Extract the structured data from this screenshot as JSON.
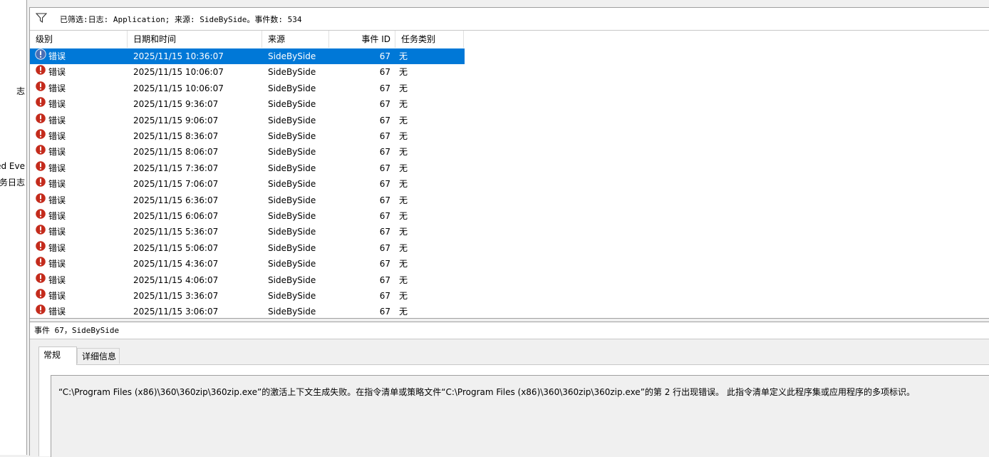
{
  "left_tree": {
    "items": [
      "志",
      "ed Eve",
      "务日志"
    ]
  },
  "filter_bar": {
    "text": "已筛选:日志: Application; 来源: SideBySide。事件数: 534"
  },
  "columns": {
    "level": "级别",
    "datetime": "日期和时间",
    "source": "来源",
    "event_id": "事件 ID",
    "task_category": "任务类别"
  },
  "events": [
    {
      "level": "错误",
      "datetime": "2025/11/15 10:36:07",
      "source": "SideBySide",
      "event_id": "67",
      "task": "无",
      "selected": true
    },
    {
      "level": "错误",
      "datetime": "2025/11/15 10:06:07",
      "source": "SideBySide",
      "event_id": "67",
      "task": "无"
    },
    {
      "level": "错误",
      "datetime": "2025/11/15 10:06:07",
      "source": "SideBySide",
      "event_id": "67",
      "task": "无"
    },
    {
      "level": "错误",
      "datetime": "2025/11/15 9:36:07",
      "source": "SideBySide",
      "event_id": "67",
      "task": "无"
    },
    {
      "level": "错误",
      "datetime": "2025/11/15 9:06:07",
      "source": "SideBySide",
      "event_id": "67",
      "task": "无"
    },
    {
      "level": "错误",
      "datetime": "2025/11/15 8:36:07",
      "source": "SideBySide",
      "event_id": "67",
      "task": "无"
    },
    {
      "level": "错误",
      "datetime": "2025/11/15 8:06:07",
      "source": "SideBySide",
      "event_id": "67",
      "task": "无"
    },
    {
      "level": "错误",
      "datetime": "2025/11/15 7:36:07",
      "source": "SideBySide",
      "event_id": "67",
      "task": "无"
    },
    {
      "level": "错误",
      "datetime": "2025/11/15 7:06:07",
      "source": "SideBySide",
      "event_id": "67",
      "task": "无"
    },
    {
      "level": "错误",
      "datetime": "2025/11/15 6:36:07",
      "source": "SideBySide",
      "event_id": "67",
      "task": "无"
    },
    {
      "level": "错误",
      "datetime": "2025/11/15 6:06:07",
      "source": "SideBySide",
      "event_id": "67",
      "task": "无"
    },
    {
      "level": "错误",
      "datetime": "2025/11/15 5:36:07",
      "source": "SideBySide",
      "event_id": "67",
      "task": "无"
    },
    {
      "level": "错误",
      "datetime": "2025/11/15 5:06:07",
      "source": "SideBySide",
      "event_id": "67",
      "task": "无"
    },
    {
      "level": "错误",
      "datetime": "2025/11/15 4:36:07",
      "source": "SideBySide",
      "event_id": "67",
      "task": "无"
    },
    {
      "level": "错误",
      "datetime": "2025/11/15 4:06:07",
      "source": "SideBySide",
      "event_id": "67",
      "task": "无"
    },
    {
      "level": "错误",
      "datetime": "2025/11/15 3:36:07",
      "source": "SideBySide",
      "event_id": "67",
      "task": "无"
    },
    {
      "level": "错误",
      "datetime": "2025/11/15 3:06:07",
      "source": "SideBySide",
      "event_id": "67",
      "task": "无"
    }
  ],
  "detail": {
    "title": "事件 67，SideBySide",
    "tabs": {
      "general": "常规",
      "details": "详细信息"
    },
    "message": "“C:\\Program Files (x86)\\360\\360zip\\360zip.exe”的激活上下文生成失败。在指令清单或策略文件“C:\\Program Files (x86)\\360\\360zip\\360zip.exe”的第 2 行出现错误。 此指令清单定义此程序集或应用程序的多项标识。"
  },
  "colors": {
    "selection": "#0078d7",
    "error_icon": "#c42b1c",
    "selected_icon": "#4a6fb5"
  }
}
